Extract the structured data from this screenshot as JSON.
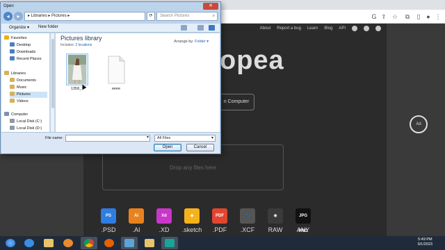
{
  "browser": {
    "colors": {
      "toolbar": "#ffffff",
      "tabstrip": "#dee1e6"
    }
  },
  "photopea": {
    "nav": [
      "About",
      "Report a bug",
      "Learn",
      "Blog",
      "API"
    ],
    "hero_title_visible": "opea",
    "open_button_visible": "n Computer",
    "drop_hint": "Drop any files here",
    "ad_badge": "Ad",
    "formats": [
      {
        "label": ".PSD",
        "icon": "psd-icon",
        "color": "#2f7de1",
        "text": "PS"
      },
      {
        "label": ".AI",
        "icon": "ai-icon",
        "color": "#e8821e",
        "text": "Ai"
      },
      {
        "label": ".XD",
        "icon": "xd-icon",
        "color": "#c936c9",
        "text": "Xd"
      },
      {
        "label": ".sketch",
        "icon": "sketch-icon",
        "color": "#f5b21b",
        "text": "◆"
      },
      {
        "label": ".PDF",
        "icon": "pdf-icon",
        "color": "#e2452f",
        "text": "PDF"
      },
      {
        "label": ".XCF",
        "icon": "gimp-icon",
        "color": "#555555",
        "text": "🐾"
      },
      {
        "label": "RAW",
        "icon": "camera-icon",
        "color": "#3a3a3a",
        "text": "◉"
      },
      {
        "label": "ANY",
        "icon": "any-format-icon",
        "color": "#111111",
        "text": "JPG PNG"
      }
    ]
  },
  "dialog": {
    "title": "Open",
    "close_glyph": "✕",
    "address": "▸ Libraries ▸ Pictures ▸",
    "search_placeholder": "Search Pictures",
    "organize": "Organize ▾",
    "new_folder": "New folder",
    "nav": [
      {
        "label": "Favorites",
        "icon": "star-icon",
        "color": "#e8b020",
        "indent": 0
      },
      {
        "label": "Desktop",
        "icon": "desktop-icon",
        "color": "#4a7fc0",
        "indent": 1
      },
      {
        "label": "Downloads",
        "icon": "downloads-icon",
        "color": "#4a7fc0",
        "indent": 1
      },
      {
        "label": "Recent Places",
        "icon": "recent-places-icon",
        "color": "#4a7fc0",
        "indent": 1
      },
      {
        "label": "Libraries",
        "icon": "library-icon",
        "color": "#d6b15c",
        "indent": 0
      },
      {
        "label": "Documents",
        "icon": "documents-icon",
        "color": "#d6b15c",
        "indent": 1
      },
      {
        "label": "Music",
        "icon": "music-icon",
        "color": "#d6b15c",
        "indent": 1
      },
      {
        "label": "Pictures",
        "icon": "pictures-icon",
        "color": "#d6b15c",
        "indent": 1,
        "selected": true
      },
      {
        "label": "Videos",
        "icon": "videos-icon",
        "color": "#d6b15c",
        "indent": 1
      },
      {
        "label": "Computer",
        "icon": "computer-icon",
        "color": "#7c93ad",
        "indent": 0
      },
      {
        "label": "Local Disk (C:)",
        "icon": "disk-icon",
        "color": "#8a9aab",
        "indent": 1
      },
      {
        "label": "Local Disk (D:)",
        "icon": "disk-icon",
        "color": "#8a9aab",
        "indent": 1
      }
    ],
    "library_title": "Pictures library",
    "library_includes": "Includes:",
    "library_locations": "2 locations",
    "arrange_by": "Arrange by:",
    "arrange_value": "Folder ▾",
    "files": [
      {
        "name": "1358_1",
        "type": "photo",
        "selected": true
      },
      {
        "name": "eeee",
        "type": "document",
        "selected": false
      }
    ],
    "file_name_label": "File name:",
    "file_name_value": "",
    "file_type": "All Files",
    "open_button": "Open",
    "cancel_button": "Cancel"
  },
  "taskbar": {
    "time": "5:49 PM",
    "date": "9/1/2023"
  }
}
